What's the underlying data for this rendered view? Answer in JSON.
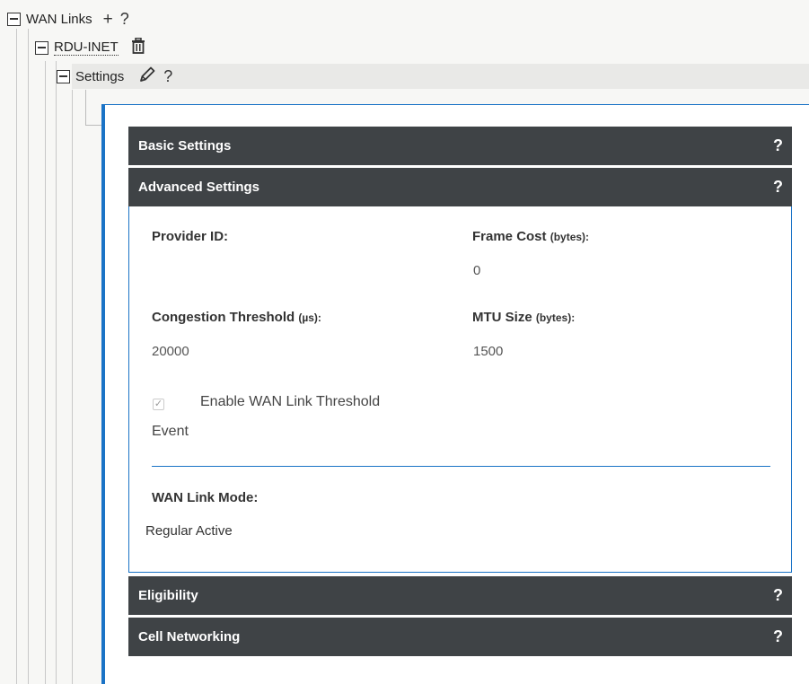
{
  "tree": {
    "root_label": "WAN Links",
    "root_add_icon": "plus-icon",
    "root_help_icon": "question-icon",
    "link_label": "RDU-INET",
    "link_delete_icon": "trash-icon",
    "settings_label": "Settings",
    "settings_edit_icon": "pencil-icon",
    "settings_help_icon": "question-icon"
  },
  "icons": {
    "plus": "+",
    "question": "?",
    "trash": "🗑",
    "pencil": "✎"
  },
  "colors": {
    "accent": "#1a73c6",
    "section_bar": "#3f4346"
  },
  "sections": [
    {
      "title": "Basic Settings",
      "help": "?"
    },
    {
      "title": "Advanced Settings",
      "help": "?"
    },
    {
      "title": "Eligibility",
      "help": "?"
    },
    {
      "title": "Cell Networking",
      "help": "?"
    }
  ],
  "advanced": {
    "provider_id": {
      "label": "Provider ID:",
      "value": ""
    },
    "frame_cost": {
      "label": "Frame Cost",
      "unit": "(bytes):",
      "value": "0"
    },
    "congestion": {
      "label": "Congestion Threshold",
      "unit": "(µs):",
      "value": "20000"
    },
    "mtu": {
      "label": "MTU Size",
      "unit": "(bytes):",
      "value": "1500"
    },
    "threshold_event": {
      "checked": true,
      "label_line1": "Enable WAN Link Threshold",
      "label_line2": "Event"
    },
    "link_mode": {
      "label": "WAN Link Mode:",
      "value": "Regular Active"
    }
  }
}
